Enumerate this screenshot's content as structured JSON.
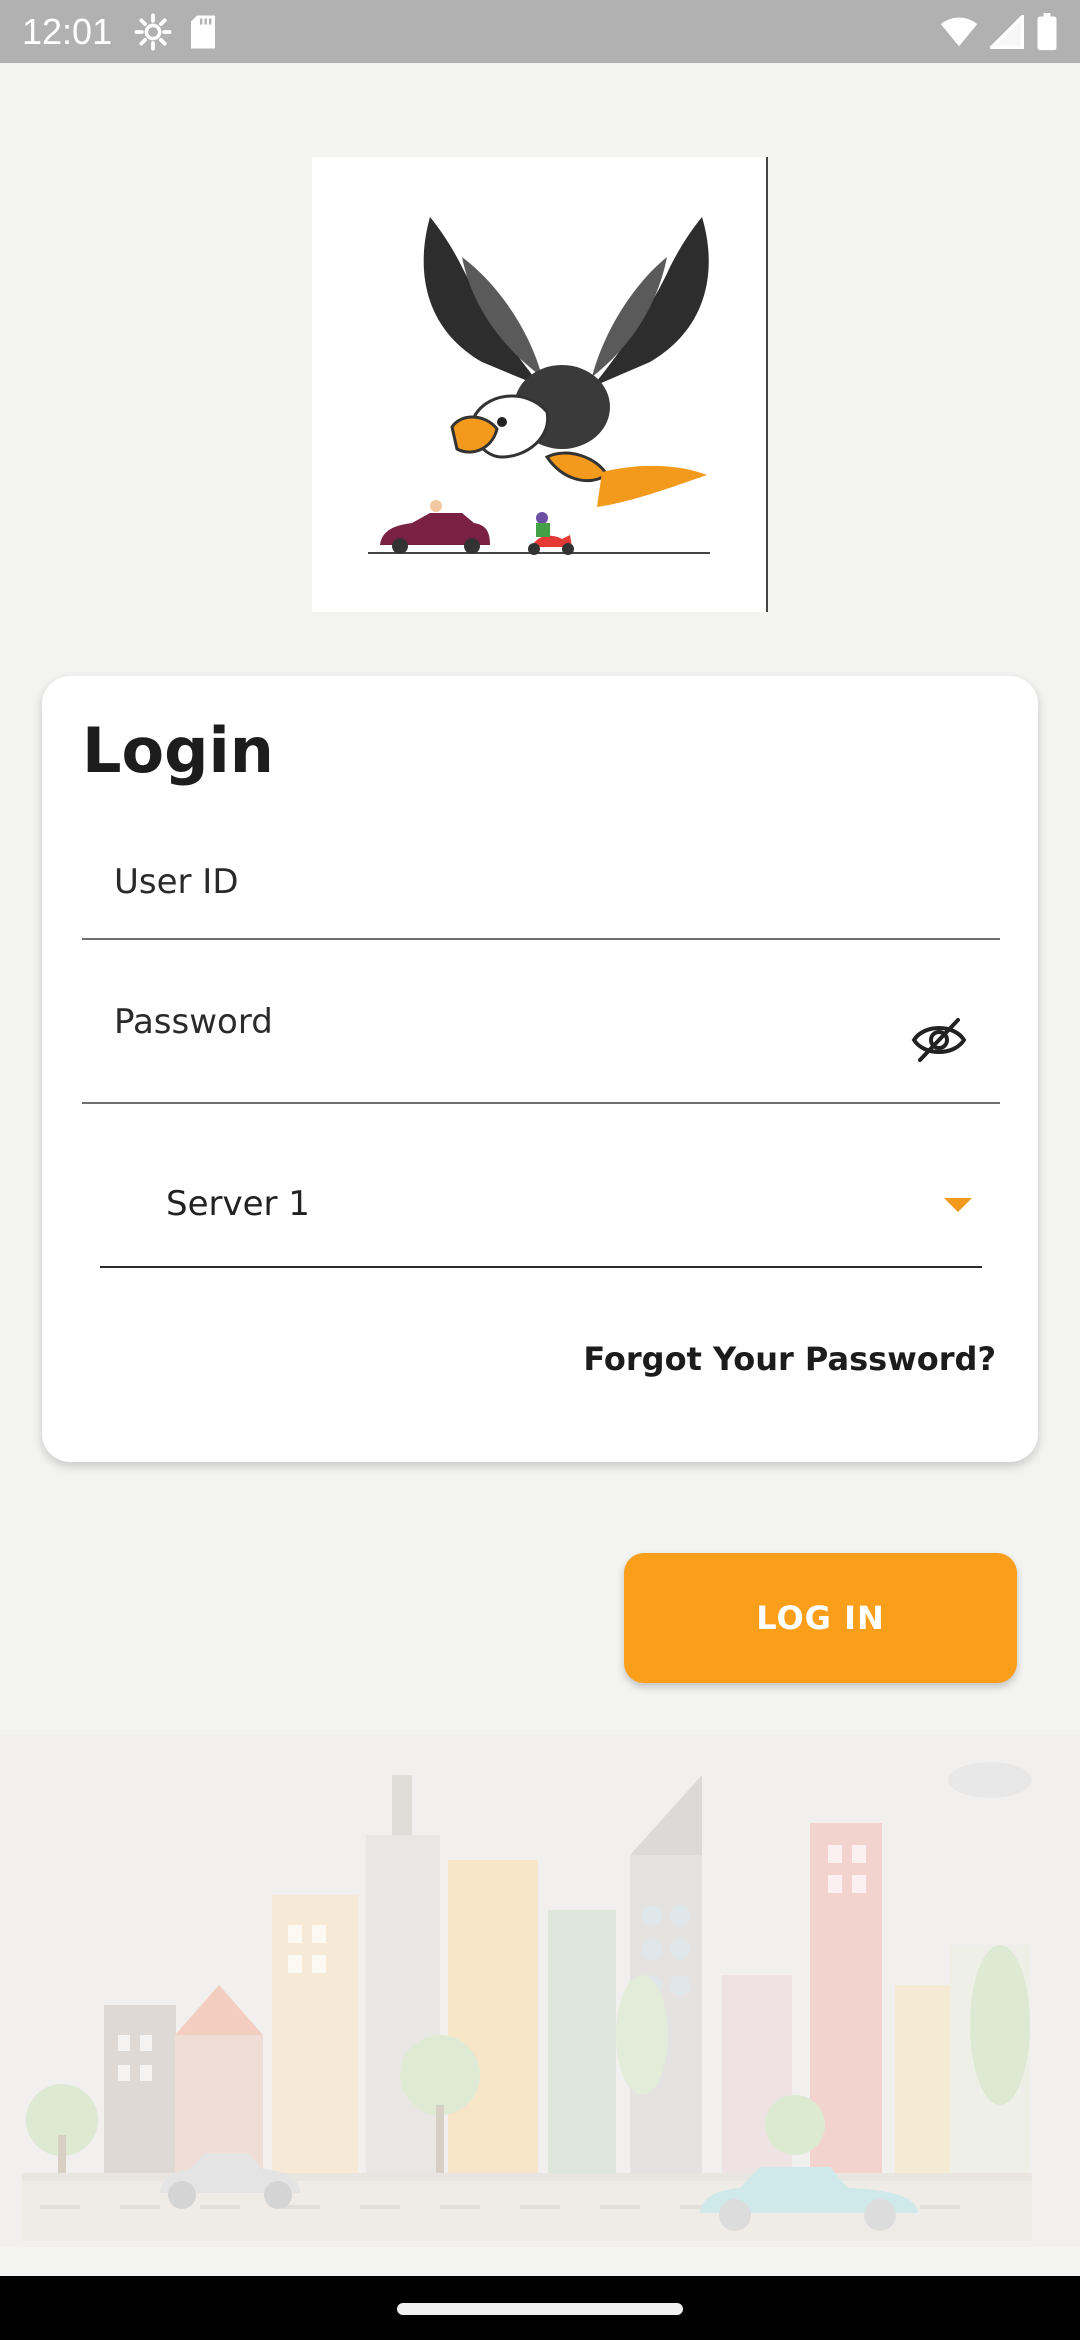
{
  "status_bar": {
    "time": "12:01",
    "icons_left": [
      "settings-icon",
      "sd-card-icon"
    ],
    "icons_right": [
      "wifi-icon",
      "signal-icon",
      "battery-icon"
    ]
  },
  "logo": {
    "icon": "eagle-logo"
  },
  "login_card": {
    "title": "Login",
    "user_id_label": "User ID",
    "password_label": "Password",
    "password_visibility_icon": "eye-off-icon",
    "server_select": {
      "selected": "Server 1",
      "arrow_icon": "dropdown-arrow-icon"
    },
    "forgot_password": "Forgot Your Password?"
  },
  "login_button": {
    "label": "LOG IN"
  },
  "colors": {
    "accent": "#fb9e1a",
    "background": "#f3f3f2",
    "card": "#ffffff",
    "status_bar": "#b1b1b1"
  }
}
